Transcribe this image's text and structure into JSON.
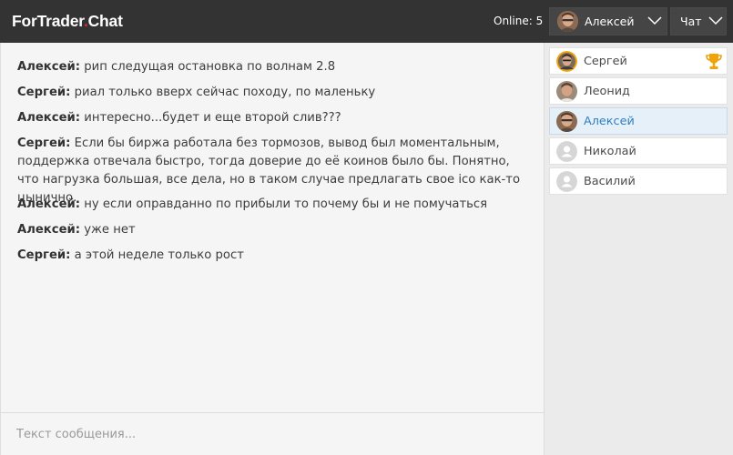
{
  "header": {
    "logo_main": "ForTrader",
    "logo_dot": ".",
    "logo_suffix": "Chat",
    "online_label": "Online: 5",
    "current_user": "Алексей",
    "chat_menu_label": "Чат"
  },
  "messages": [
    {
      "author": "Алексей:",
      "text": "рип следущая остановка по волнам 2.8"
    },
    {
      "author": "Сергей:",
      "text": "риал только вверх сейчас походу, по маленьку"
    },
    {
      "author": "Алексей:",
      "text": "интересно...будет и еще второй слив???"
    },
    {
      "author": "Сергей:",
      "text": "Если бы биржа работала без тормозов, вывод был моментальным, поддержка отвечала быстро, тогда доверие до её коинов было бы. Понятно, что нагрузка большая, все дела, но в таком случае предлагать свое ico как-то цынично."
    },
    {
      "author": "Алексей:",
      "text": "ну если оправданно по прибыли то почему бы и не помучаться"
    },
    {
      "author": "Алексей:",
      "text": "уже нет"
    },
    {
      "author": "Сергей:",
      "text": "а этой неделе только рост"
    }
  ],
  "composer": {
    "placeholder": "Текст сообщения..."
  },
  "users": [
    {
      "name": "Сергей",
      "avatar": "photo-avatar",
      "badge": "trophy-icon",
      "active": false
    },
    {
      "name": "Леонид",
      "avatar": "photo-avatar",
      "active": false
    },
    {
      "name": "Алексей",
      "avatar": "photo-avatar",
      "active": true
    },
    {
      "name": "Николай",
      "avatar": "default-avatar",
      "active": false
    },
    {
      "name": "Василий",
      "avatar": "default-avatar",
      "active": false
    }
  ],
  "colors": {
    "header_bg": "#333333",
    "logo_dot": "#e8272a",
    "active_user_text": "#2e7fc1",
    "active_user_bg": "#e6f0f9",
    "trophy": "#f0a30a"
  }
}
